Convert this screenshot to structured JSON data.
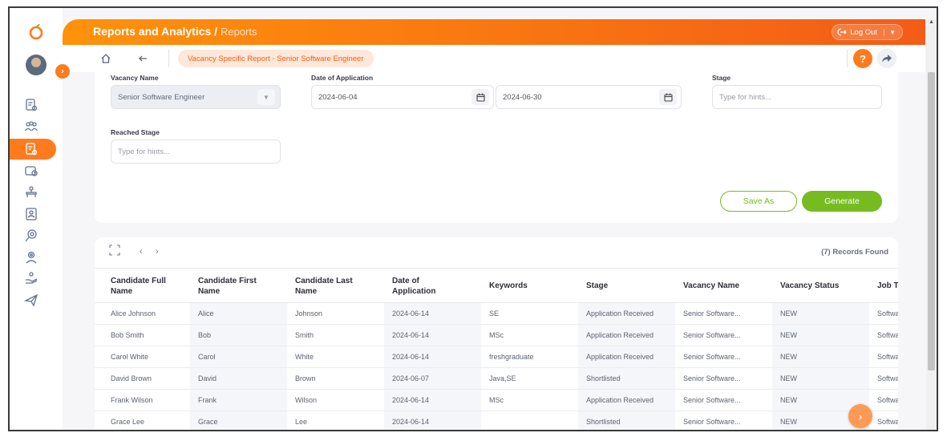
{
  "header": {
    "title": "Reports and Analytics",
    "title_sep": " / ",
    "subtitle": "Reports",
    "logout_label": "Log Out"
  },
  "subbar": {
    "breadcrumb_chip": "Vacancy Specific Report - Senior Software Engineer",
    "help_label": "?"
  },
  "filters": {
    "vacancy_name_label": "Vacancy Name",
    "vacancy_name_value": "Senior Software Engineer",
    "date_label": "Date of Application",
    "date_from": "2024-06-04",
    "date_to": "2024-06-30",
    "stage_label": "Stage",
    "stage_placeholder": "Type for hints...",
    "reached_stage_label": "Reached Stage",
    "reached_stage_placeholder": "Type for hints...",
    "save_as_label": "Save As",
    "generate_label": "Generate"
  },
  "table": {
    "records_found": "(7) Records Found",
    "columns": [
      "Candidate Full\nName",
      "Candidate First\nName",
      "Candidate Last\nName",
      "Date of\nApplication",
      "Keywords",
      "Stage",
      "Vacancy Name",
      "Vacancy Status",
      "Job T"
    ],
    "rows": [
      [
        "Alice Johnson",
        "Alice",
        "Johnson",
        "2024-06-14",
        "SE",
        "Application Received",
        "Senior Software...",
        "NEW",
        "Softwa"
      ],
      [
        "Bob Smith",
        "Bob",
        "Smith",
        "2024-06-14",
        "MSc",
        "Application Received",
        "Senior Software...",
        "NEW",
        "Softwa"
      ],
      [
        "Carol White",
        "Carol",
        "White",
        "2024-06-14",
        "freshgraduate",
        "Application Received",
        "Senior Software...",
        "NEW",
        "Softwa"
      ],
      [
        "David Brown",
        "David",
        "Brown",
        "2024-06-07",
        "Java,SE",
        "Shortlisted",
        "Senior Software...",
        "NEW",
        "Softwa"
      ],
      [
        "Frank Wilson",
        "Frank",
        "Wilson",
        "2024-06-14",
        "MSc",
        "Application Received",
        "Senior Software...",
        "NEW",
        "Softwa"
      ],
      [
        "Grace Lee",
        "Grace",
        "Lee",
        "2024-06-14",
        "",
        "Shortlisted",
        "Senior Software...",
        "NEW",
        "Softwa"
      ]
    ]
  },
  "icons": {
    "sidebar": [
      "admin-icon",
      "pim-icon",
      "recruitment-icon",
      "time-icon",
      "directory-icon",
      "my-info-icon",
      "performance-icon",
      "buzz-icon",
      "claim-icon",
      "travel-icon"
    ]
  },
  "colors": {
    "brand_orange": "#ff7b1d",
    "header_gradient_start": "#ff920b",
    "header_gradient_end": "#f35c17",
    "action_green": "#76bc21"
  }
}
